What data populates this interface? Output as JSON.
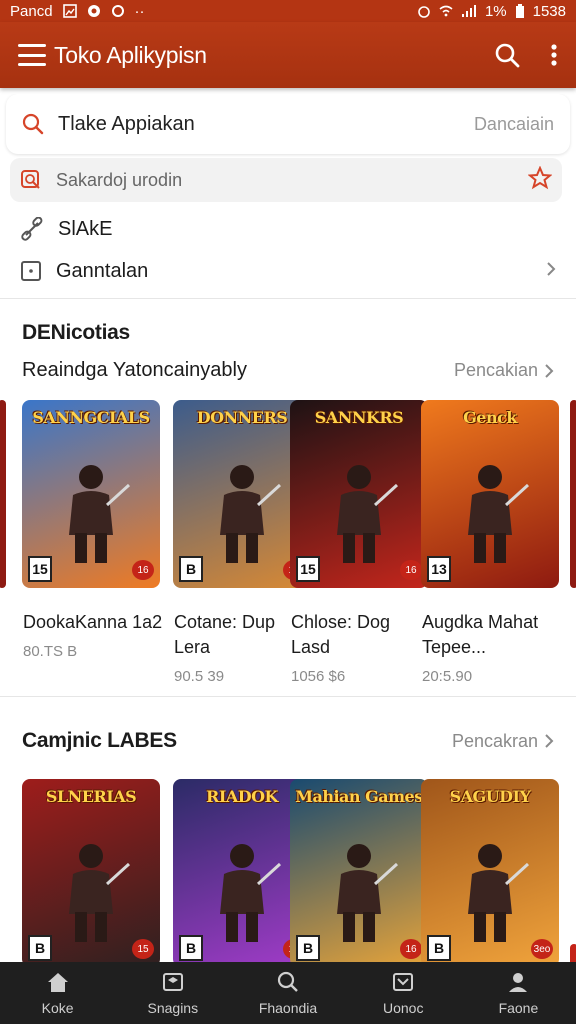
{
  "status_bar": {
    "carrier": "Pancd",
    "battery": "1%",
    "time": "1538"
  },
  "app_bar": {
    "title": "Toko Aplikypisn"
  },
  "search": {
    "query": "Tlake Appiakan",
    "right_label": "Dancaiain",
    "sub_query": "Sakardoj urodin"
  },
  "rows": [
    {
      "label": "SlAkE"
    },
    {
      "label": "Ganntalan"
    }
  ],
  "section1": {
    "title": "DENicotias",
    "subtitle": "Reaindga Yatoncainyably",
    "more": "Pencakian",
    "cards": [
      {
        "title": "SANNGCIALS",
        "rating": "15",
        "badge": "16",
        "name": "DookaKanna 1a2",
        "size": "80.TS B",
        "colors": [
          "#3a76c9",
          "#ef7b23"
        ]
      },
      {
        "title": "DONNERS",
        "rating": "B",
        "badge": "15",
        "name": "Cotane: Dup Lera",
        "size": "90.5 39",
        "colors": [
          "#3c5c8c",
          "#d88934"
        ]
      },
      {
        "title": "SANNKRS",
        "rating": "15",
        "badge": "16",
        "name": "Chlose: Dog Lasd",
        "size": "1056 $6",
        "colors": [
          "#1d1214",
          "#c4261c"
        ]
      },
      {
        "title": "Genck",
        "rating": "13",
        "badge": "",
        "name": "Augdka Mahat Tepee...",
        "size": "20:5.90",
        "colors": [
          "#f07a1d",
          "#8e1a10"
        ]
      }
    ]
  },
  "section2": {
    "title": "Camjnic LABES",
    "more": "Pencakran",
    "cards": [
      {
        "title": "SLNERIAS",
        "rating": "B",
        "badge": "15",
        "colors": [
          "#9e1d1b",
          "#2e2020"
        ]
      },
      {
        "title": "RIADOK",
        "rating": "B",
        "badge": "16",
        "colors": [
          "#2b2b66",
          "#a23cc9"
        ]
      },
      {
        "title": "Mahian Games",
        "rating": "B",
        "badge": "16",
        "colors": [
          "#194a70",
          "#e7a43a"
        ]
      },
      {
        "title": "SAGUDIY",
        "rating": "B",
        "badge": "3eo",
        "colors": [
          "#a0561a",
          "#f1a43c"
        ]
      }
    ]
  },
  "bottom_nav": [
    {
      "label": "Koke",
      "icon": "home-icon"
    },
    {
      "label": "Snagins",
      "icon": "games-icon"
    },
    {
      "label": "Fhaondia",
      "icon": "search-icon"
    },
    {
      "label": "Uonoc",
      "icon": "updates-icon"
    },
    {
      "label": "Faone",
      "icon": "profile-icon"
    }
  ],
  "colors": {
    "accent": "#b43513",
    "nav_bg": "#1f1f1f"
  }
}
